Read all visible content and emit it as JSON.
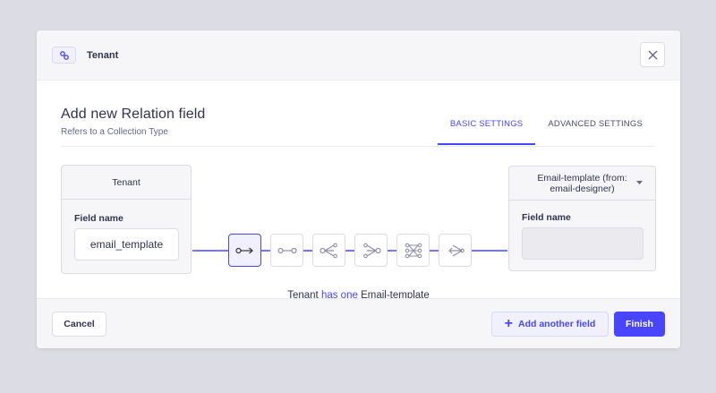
{
  "header": {
    "title": "Tenant",
    "icon": "link-icon",
    "close_icon": "close-icon"
  },
  "main": {
    "title": "Add new Relation field",
    "subtitle": "Refers to a Collection Type",
    "tabs": [
      {
        "label": "BASIC SETTINGS",
        "active": true
      },
      {
        "label": "ADVANCED SETTINGS",
        "active": false
      }
    ]
  },
  "left_card": {
    "title": "Tenant",
    "field_label": "Field name",
    "field_value": "email_template"
  },
  "right_card": {
    "title": "Email-template (from: email-designer)",
    "field_label": "Field name",
    "field_value": ""
  },
  "relations": {
    "types": [
      "one-way",
      "one-to-one",
      "one-to-many",
      "many-to-one",
      "many-to-many",
      "many-way"
    ],
    "selected": "one-way",
    "sentence": {
      "subject": "Tenant",
      "verb": "has one",
      "object": "Email-template"
    }
  },
  "footer": {
    "cancel_label": "Cancel",
    "add_label": "Add another field",
    "finish_label": "Finish"
  },
  "colors": {
    "accent": "#4945ff",
    "background": "#dcdce4",
    "panel": "#f6f6f9"
  }
}
